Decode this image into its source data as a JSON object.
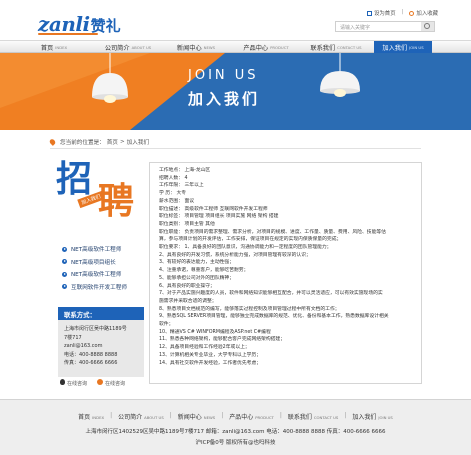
{
  "header": {
    "logo_latin": "zanli",
    "logo_cn": "赞礼",
    "toplinks": [
      "设为首页",
      "加入收藏"
    ],
    "search_placeholder": "请输入关键字"
  },
  "nav": [
    {
      "cn": "首页",
      "en": "INDEX",
      "active": false
    },
    {
      "cn": "公司简介",
      "en": "ABOUT US",
      "active": false
    },
    {
      "cn": "新闻中心",
      "en": "NEWS",
      "active": false
    },
    {
      "cn": "产品中心",
      "en": "PRODUCT",
      "active": false
    },
    {
      "cn": "联系我们",
      "en": "CONTACT US",
      "active": false
    },
    {
      "cn": "加入我们",
      "en": "JOIN US",
      "active": true
    }
  ],
  "banner": {
    "title_en": "JOIN  US",
    "title_cn": "加入我们"
  },
  "breadcrumb": {
    "prefix": "您当前的位置是：",
    "home": "首页",
    "sep": ">",
    "current": "加入我们"
  },
  "sidebar": {
    "recruit_char1": "招",
    "recruit_char2": "聘",
    "recruit_tag": "加入我们",
    "jobs": [
      "NET高级软件工程师",
      "NET高级项目组长",
      "NET高级软件工程师",
      "互联网软件开发工程师"
    ],
    "contact_title": "联系方式：",
    "contact_lines": [
      "上海市闵行区吴中路1189号",
      "7楼717",
      "zanli@163.com",
      "电话：400-8888 8888",
      "传真：400-6666 6666"
    ],
    "im": [
      "在线咨询",
      "在线咨询"
    ]
  },
  "content": {
    "lines": [
      "工作地点：   上海-龙山区",
      "招聘人数：   4",
      "工作年限：   三年以上",
      "学    历：   大专",
      "薪水范围：   面议",
      "职位描述：   高级软件工程师 互联网软件开发工程师",
      "职位标签：   项目管理 项目组长 项目实施 网络 架构 搭建",
      "职位类别：   项目主管 其他",
      "职位职能：   负责项目的需求整理、需求分析，对项目的规模、进度、工作量、质量、费用、风险、技能等估",
      "算，参与项目计划的开发评估，工作安排，保证项目在规定的实现内保质保量的完成；",
      "职位要求：   1、具备良好的团队意识，沟通协调能力和一定程度的团队管理能力；",
      "2、具有良好的开发习惯，系统分析能力强，对项目管理有较深的认识；",
      "3、有较好的表达能力，主动性强；",
      "4、注重承诺，尊重客户，能够吃苦耐劳；",
      "5、能够承担公司对外的团队精神；",
      "6、具有良好的职业操守；",
      "7、对于产品实施兴趣度的人员，软件和网络知识能够相互配合，并可以灵活适应，可以有效实施现场的实",
      "施需求并采取合适的调整；",
      "8、熟悉项目文档规范的编写，能够落实过程控制及项目管理过程中所有文档的工作；",
      "9、熟悉SQL SERVER项目管理，能够独立完成数据库的规范、优化、备份和基本工作，熟悉数据库设计相关",
      "软件；",
      "10、精通VS C# WINFORM编程及ASP.net C#编程",
      "11、熟悉各种网络架构，能够配合客户完成网络架构搭建；",
      "12、具备项目经验和工作经验2年或以上；",
      "13、计算机相关专业毕业，大学专科以上学历；",
      "14、具有社交软件开发经验，工作者优先考虑；"
    ]
  },
  "footer": {
    "nav": [
      {
        "cn": "首页",
        "en": "INDEX"
      },
      {
        "cn": "公司简介",
        "en": "ABOUT US"
      },
      {
        "cn": "新闻中心",
        "en": "NEWS"
      },
      {
        "cn": "产品中心",
        "en": "PRODUCT"
      },
      {
        "cn": "联系我们",
        "en": "CONTACT US"
      },
      {
        "cn": "加入我们",
        "en": "JOIN US"
      }
    ],
    "address": "上海市闵行区1402529区吴中路1189号7楼717    邮箱：zanli@163.com    电话：400-8888 8888    传真：400-6666 6666",
    "icp": "沪ICP备0号    版权所有@也吗科技"
  },
  "colors": {
    "primary": "#1e63b8",
    "accent": "#e87722",
    "footer_bg": "#eeeeee"
  }
}
